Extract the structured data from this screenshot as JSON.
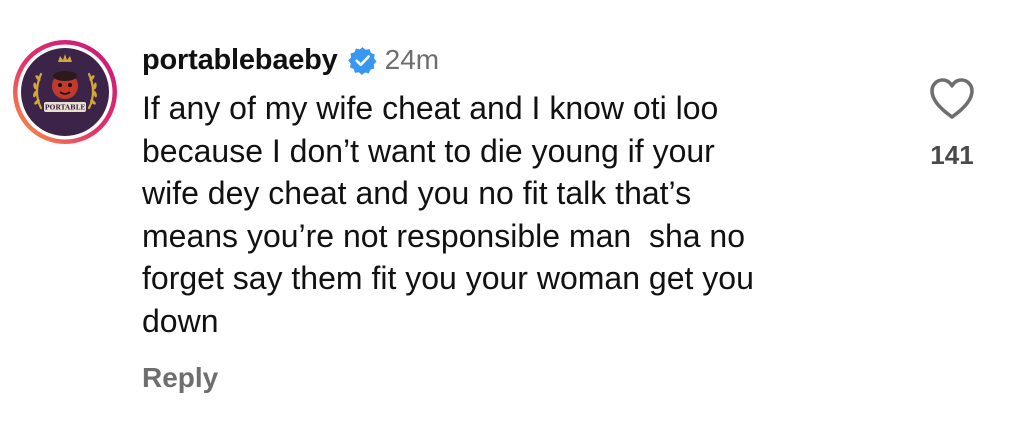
{
  "comment": {
    "avatar_text": "PORTABLE",
    "username": "portablebaeby",
    "verified_icon": "verified-badge-icon",
    "time": "24m",
    "lines": [
      "If any of my wife cheat and I know oti loo",
      "because I don’t want to die young if your",
      "wife dey cheat and you no fit talk that’s",
      "means you’re not responsible man  sha no",
      "forget say them fit you your woman get you",
      "down"
    ],
    "reply_label": "Reply",
    "like_icon": "heart-icon",
    "like_count": "141"
  },
  "colors": {
    "verified": "#3897f0",
    "muted": "#6e6e6e",
    "text": "#111111"
  }
}
